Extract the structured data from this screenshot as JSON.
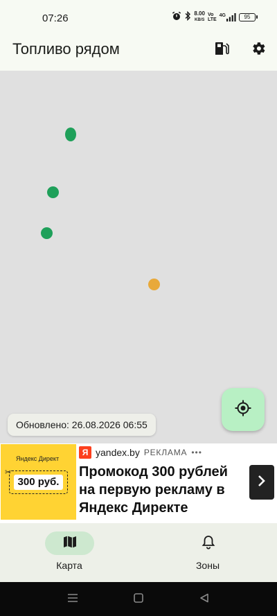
{
  "status_bar": {
    "time": "07:26",
    "network_speed_value": "8.00",
    "network_speed_unit": "KB/S",
    "volte_label_top": "Vo",
    "volte_label_bottom": "LTE",
    "network_type": "4G",
    "battery_level": "95",
    "icons": [
      "alarm-icon",
      "bluetooth-icon",
      "signal-icon",
      "battery-icon"
    ]
  },
  "app_bar": {
    "title": "Топливо рядом",
    "actions": [
      "fuel-pump-icon",
      "gear-icon"
    ]
  },
  "map": {
    "background": "#e0e0e0",
    "markers": [
      {
        "id": "station-1",
        "color": "#1fa05a"
      },
      {
        "id": "station-2",
        "color": "#1fa05a"
      },
      {
        "id": "station-3",
        "color": "#1fa05a"
      },
      {
        "id": "station-4",
        "color": "#e8a93a"
      }
    ],
    "my_location_icon": "crosshair-icon",
    "updated_text": "Обновлено: 26.08.2026 06:55"
  },
  "ad": {
    "image_brand": "Яндекс Директ",
    "image_price": "300 руб.",
    "source_logo": "Я",
    "source_domain": "yandex.by",
    "label": "РЕКЛАМА",
    "dots": "•••",
    "headline": "Промокод 300 рублей на первую рекламу в Яндекс Директе",
    "arrow_icon": "chevron-right-icon"
  },
  "bottom_nav": {
    "items": [
      {
        "label": "Карта",
        "icon": "map-icon",
        "active": true
      },
      {
        "label": "Зоны",
        "icon": "bell-icon",
        "active": false
      }
    ]
  },
  "colors": {
    "accent_fab": "#b8f0c4",
    "nav_active_pill": "#cde8cf",
    "marker_green": "#1fa05a",
    "marker_orange": "#e8a93a"
  }
}
